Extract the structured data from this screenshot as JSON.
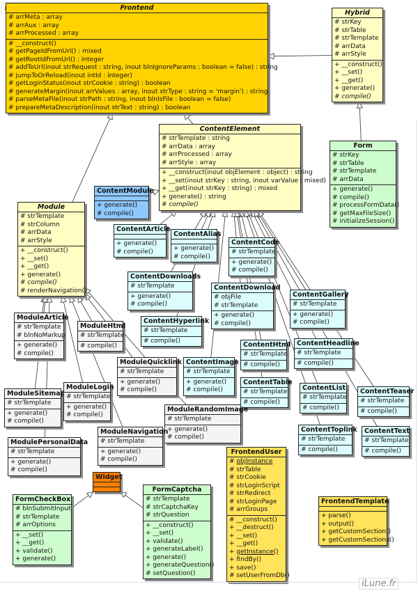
{
  "watermark": "iLune.fr",
  "classes": {
    "frontend": {
      "name": "Frontend",
      "abstract": true,
      "color": "#ffd200",
      "attributes": [
        "# arrMeta : array",
        "# arrAux : array",
        "# arrProcessed : array"
      ],
      "methods": [
        "# __construct()",
        "# getPageIdFromUrl() : mixed",
        "# getRootIdFromUrl() : integer",
        "# addToUrl(inout strRequest : string, inout blnIgnoreParams : boolean = false) : string",
        "# jumpToOrReload(inout intId : integer)",
        "# getLoginStatus(inout strCookie : string) : boolean",
        "# generateMargin(inout arrValues : array, inout strType : string = 'margin') : string",
        "# parseMetaFile(inout strPath : string, inout blnIsFile : boolean = false)",
        "# prepareMetaDescription(inout strText : string) : boolean"
      ]
    },
    "hybrid": {
      "name": "Hybrid",
      "abstract": true,
      "color": "#fffdc2",
      "attributes": [
        "# strKey",
        "# strTable",
        "# strTemplate",
        "# arrData",
        "# arrStyle"
      ],
      "methods": [
        "+ __construct()",
        "+ __set()",
        "+ __get()",
        "+ generate()",
        "# compile()"
      ]
    },
    "form": {
      "name": "Form",
      "color": "#cdfdcd",
      "attributes": [
        "# strKey",
        "# strTable",
        "# strTemplate",
        "# arrData"
      ],
      "methods": [
        "+ generate()",
        "# compile()",
        "# processFormData()",
        "# getMaxFileSize()",
        "# initializeSession()"
      ]
    },
    "content_element": {
      "name": "ContentElement",
      "abstract": true,
      "color": "#fffdc2",
      "attributes": [
        "# strTemplate : string",
        "# arrData : array",
        "# arrProcessed : array",
        "# arrStyle : array"
      ],
      "methods": [
        "+ __construct(inout objElement : object) : string",
        "+ __set(inout strKey : string, inout varValue : mixed)",
        "+ __get(inout strKey : string) : mixed",
        "+ generate() : string",
        "# compile()"
      ]
    },
    "content_module": {
      "name": "ContentModule",
      "color": "#8ec8ff",
      "attributes": [],
      "methods": [
        "+ generate()",
        "# compile()"
      ]
    },
    "module": {
      "name": "Module",
      "abstract": true,
      "color": "#fffdc2",
      "attributes": [
        "# strTemplate",
        "# strColumn",
        "# arrData",
        "# arrStyle"
      ],
      "methods": [
        "+ __construct()",
        "+ __set()",
        "+ __get()",
        "+ generate()",
        "# compile()",
        "# renderNavigation()"
      ]
    },
    "content_article": {
      "name": "ContentArticle",
      "attributes": [],
      "methods": [
        "+ generate()",
        "# compile()"
      ]
    },
    "content_alias": {
      "name": "ContentAlias",
      "attributes": [],
      "methods": [
        "+ generate()",
        "# compile()"
      ]
    },
    "content_code": {
      "name": "ContentCode",
      "attributes": [
        "# strTemplate"
      ],
      "methods": [
        "+ generate()",
        "# compile()"
      ]
    },
    "content_downloads": {
      "name": "ContentDownloads",
      "attributes": [
        "# strTemplate"
      ],
      "methods": [
        "+ generate()",
        "# compile()"
      ]
    },
    "content_download": {
      "name": "ContentDownload",
      "attributes": [
        "# objFile",
        "# strTemplate"
      ],
      "methods": [
        "+ generate()",
        "# compile()"
      ]
    },
    "content_gallery": {
      "name": "ContentGallery",
      "attributes": [
        "# strTemplate"
      ],
      "methods": [
        "+ generate()",
        "# compile()"
      ]
    },
    "content_hyperlink": {
      "name": "ContentHyperlink",
      "attributes": [
        "# strTemplate"
      ],
      "methods": [
        "# compile()"
      ]
    },
    "content_headline": {
      "name": "ContentHeadline",
      "attributes": [
        "# strTemplate"
      ],
      "methods": [
        "# compile()"
      ]
    },
    "content_html": {
      "name": "ContentHtml",
      "attributes": [
        "# strTemplate"
      ],
      "methods": [
        "# compile()"
      ]
    },
    "content_image": {
      "name": "ContentImage",
      "attributes": [
        "# strTemplate"
      ],
      "methods": [
        "+ generate()",
        "# compile()"
      ]
    },
    "content_table": {
      "name": "ContentTable",
      "attributes": [
        "# strTemplate"
      ],
      "methods": [
        "# compile()"
      ]
    },
    "content_list": {
      "name": "ContentList",
      "attributes": [
        "# strTemplate"
      ],
      "methods": [
        "# compile()"
      ]
    },
    "content_teaser": {
      "name": "ContentTeaser",
      "attributes": [
        "# strTemplate"
      ],
      "methods": [
        "# compile()"
      ]
    },
    "content_toplink": {
      "name": "ContentToplink",
      "attributes": [
        "# strTemplate"
      ],
      "methods": [
        "# compile()"
      ]
    },
    "content_text": {
      "name": "ContentText",
      "attributes": [
        "# strTemplate"
      ],
      "methods": [
        "# compile()"
      ]
    },
    "module_article": {
      "name": "ModuleArticle",
      "attributes": [
        "# strTemplate",
        "# blnNoMarkup"
      ],
      "methods": [
        "+ generate()",
        "# compile()"
      ]
    },
    "module_html": {
      "name": "ModuleHtml",
      "attributes": [
        "# strTemplate"
      ],
      "methods": [
        "# compile()"
      ]
    },
    "module_quicklink": {
      "name": "ModuleQuicklink",
      "attributes": [
        "# strTemplate"
      ],
      "methods": [
        "+ generate()",
        "# compile()"
      ]
    },
    "module_sitemap": {
      "name": "ModuleSitemap",
      "attributes": [
        "# strTemplate"
      ],
      "methods": [
        "+ generate()",
        "# compile()"
      ]
    },
    "module_login": {
      "name": "ModuleLogin",
      "attributes": [
        "# strTemplate"
      ],
      "methods": [
        "+ generate()",
        "# compile()"
      ]
    },
    "module_random_image": {
      "name": "ModuleRandomImage",
      "attributes": [
        "# strTemplate"
      ],
      "methods": [
        "+ generate()",
        "# compile()"
      ]
    },
    "module_navigation": {
      "name": "ModuleNavigation",
      "attributes": [
        "# strTemplate"
      ],
      "methods": [
        "+ generate()",
        "# compile()"
      ]
    },
    "module_personal_data": {
      "name": "ModulePersonalData",
      "attributes": [
        "# strTemplate"
      ],
      "methods": [
        "+ generate()",
        "# compile()"
      ]
    },
    "widget": {
      "name": "Widget",
      "color": "#ff8000",
      "attributes": [],
      "methods": []
    },
    "form_checkbox": {
      "name": "FormCheckBox",
      "color": "#cdfdcd",
      "attributes": [
        "# blnSubmitInput",
        "# strTemplate",
        "# arrOptions"
      ],
      "methods": [
        "+ __set()",
        "+ __get()",
        "+ validate()",
        "+ generate()"
      ]
    },
    "form_captcha": {
      "name": "FormCaptcha",
      "color": "#cdfdcd",
      "attributes": [
        "# strTemplate",
        "# strCaptchaKey",
        "# strQuestion"
      ],
      "methods": [
        "+ __construct()",
        "+ __set()",
        "+ validate()",
        "+ generateLabel()",
        "+ generate()",
        "+ generateQuestion()",
        "# setQuestion()"
      ]
    },
    "frontend_user": {
      "name": "FrontendUser",
      "color": "#ffe35a",
      "attributes": [
        "# objInstance",
        "# strTable",
        "# strCookie",
        "# strLoginScript",
        "# strRedirect",
        "# strLoginPage",
        "# arrGroups"
      ],
      "static_attributes": [
        "# objInstance"
      ],
      "methods": [
        "# __construct()",
        "+ __destruct()",
        "+ __set()",
        "+ __get()",
        "+ getInstance()",
        "+ findBy()",
        "+ save()",
        "# setUserFromDb()"
      ],
      "static_methods": [
        "+ getInstance()"
      ]
    },
    "frontend_template": {
      "name": "FrontendTemplate",
      "color": "#ffe35a",
      "attributes": [],
      "methods": [
        "+ parse()",
        "+ output()",
        "+ getCustomSection()",
        "+ getCustomSections()"
      ]
    }
  },
  "relations": [
    [
      "hybrid",
      "frontend"
    ],
    [
      "module",
      "frontend"
    ],
    [
      "content_element",
      "frontend"
    ],
    [
      "form",
      "hybrid"
    ],
    [
      "content_module",
      "content_element"
    ],
    [
      "content_article",
      "content_element"
    ],
    [
      "content_alias",
      "content_element"
    ],
    [
      "content_code",
      "content_element"
    ],
    [
      "content_downloads",
      "content_element"
    ],
    [
      "content_download",
      "content_element"
    ],
    [
      "content_gallery",
      "content_element"
    ],
    [
      "content_hyperlink",
      "content_element"
    ],
    [
      "content_headline",
      "content_element"
    ],
    [
      "content_html",
      "content_element"
    ],
    [
      "content_image",
      "content_element"
    ],
    [
      "content_table",
      "content_element"
    ],
    [
      "content_list",
      "content_element"
    ],
    [
      "content_teaser",
      "content_element"
    ],
    [
      "content_toplink",
      "content_element"
    ],
    [
      "content_text",
      "content_element"
    ],
    [
      "module_article",
      "module"
    ],
    [
      "module_html",
      "module"
    ],
    [
      "module_quicklink",
      "module"
    ],
    [
      "module_sitemap",
      "module"
    ],
    [
      "module_login",
      "module"
    ],
    [
      "module_random_image",
      "module"
    ],
    [
      "module_navigation",
      "module"
    ],
    [
      "module_personal_data",
      "module"
    ],
    [
      "form_checkbox",
      "widget"
    ],
    [
      "form_captcha",
      "widget"
    ]
  ]
}
